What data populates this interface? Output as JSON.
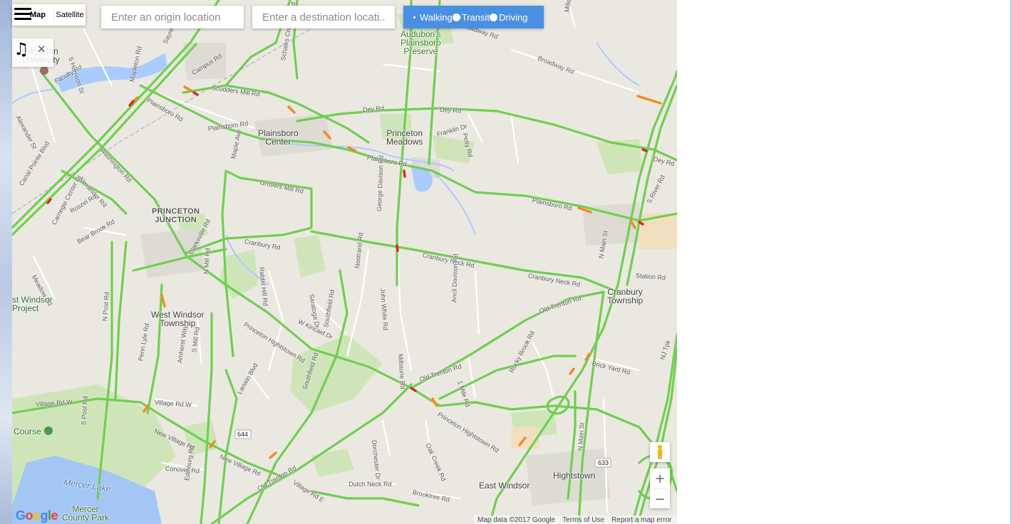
{
  "map_type": {
    "map_label": "Map",
    "satellite_label": "Satellite",
    "selected": "Map"
  },
  "origin": {
    "placeholder": "Enter an origin location",
    "value": ""
  },
  "destination": {
    "placeholder": "Enter a destination locati...",
    "value": ""
  },
  "travel_modes": {
    "selected": "Walking",
    "walking": "Walking",
    "transit": "Transit",
    "driving": "Driving"
  },
  "icons": {
    "menu": "hamburger-icon",
    "music": "music-note-icon",
    "close": "close-icon",
    "pegman": "pegman-icon",
    "zoom_in": "plus-icon",
    "zoom_out": "minus-icon"
  },
  "zoom": {
    "in": "+",
    "out": "−"
  },
  "attribution": {
    "data": "Map data ©2017 Google",
    "terms": "Terms of Use",
    "report": "Report a map error"
  },
  "logo": "Google",
  "places": {
    "princeton_university": "Princeton\nUniversity",
    "plainsboro_center": "Plainsboro\nCenter",
    "princeton_meadows": "Princeton\nMeadows",
    "audubon": "Audubon's\nPlainsboro\nPreserve",
    "princeton_junction": "PRINCETON\nJUNCTION",
    "west_windsor": "West Windsor\nTownship",
    "cranbury": "Cranbury\nTownship",
    "hightstown": "Hightstown",
    "east_windsor": "East Windsor",
    "mercer_lake": "Mercer Lake",
    "mercer_park": "Mercer\nCounty Park",
    "windsor_project": "st Windsor\nProject",
    "course": "Course"
  },
  "roads": {
    "broadway": "Broadway Rd",
    "dey1": "Dey Rd",
    "dey2": "Dey Rd",
    "dey3": "Dey Rd",
    "scudders": "Scudders Mill Rd",
    "plainsboro1": "Plainsboro Rd",
    "plainsboro2": "Plainsboro Rd",
    "plainsboro3": "Plainsboro Rd",
    "plainsboro4": "Plainsboro Rd",
    "groversmill": "Grovers Mill Rd",
    "cranbury": "Cranbury Rd",
    "cranburyneck1": "Cranbury Neck Rd",
    "cranburyneck2": "Cranbury Neck Rd",
    "station": "Station Rd",
    "oldtrenton1": "Old Trenton Rd",
    "oldtrenton2": "Old Trenton Rd",
    "oldtrenton3": "Old Trenton Rd",
    "pht1": "Princeton Hightstown Rd",
    "pht2": "Princeton Hightstown Rd",
    "villagew1": "Village Rd W",
    "villagew2": "Village Rd W",
    "newvillage1": "New Village Rd",
    "newvillage2": "New Village Rd",
    "villagee": "Village Rd E",
    "conover": "Conover Rd",
    "dutchneck": "Dutch Neck Rd",
    "brooktree": "Brooktree Rd",
    "brickyard": "Brick Yard Rd",
    "nmain1": "N Main St",
    "nmain2": "N Main St",
    "sriver": "S River Rd",
    "washington": "Washington Rd",
    "alexander1": "Alexander Rd",
    "alexander2": "Alexander St",
    "harrison": "S Harrison St",
    "canalpointe": "Canal Pointe Blvd",
    "roszel": "Roszel Rd",
    "bearbrook": "Bear Brook Rd",
    "meadow": "Meadow Rd",
    "clarksville": "Clarksville Rd",
    "nmill": "N Mill Rd",
    "rabbithill": "Rabbit Hill Rd",
    "saratoga": "Saratoga Dr",
    "wkincaid": "W Kincaid Dr",
    "southfield1": "Southfield Rd",
    "southfield2": "Southfield Rd",
    "nostrand": "Nostrand Rd",
    "johnwhite": "John White Rd",
    "georgedavison": "George Davison Rd",
    "millstone": "Millstone Rd",
    "ancildavison": "Ancil Davison Rd",
    "npost": "N Post Rd",
    "spost": "S Post Rd",
    "pennlyle": "Penn Lyle Rd",
    "amherst": "Amherst Way",
    "smill": "S Mill Rd",
    "lanwin": "Lanwin Blvd",
    "edinburg": "Edinburg Rd",
    "oakcreek": "Oak Creek Rd",
    "dorchester": "Dorchester Dr",
    "onemile": "1 Mile Rd",
    "rockybrook": "Rocky Brook Rd",
    "schalks": "Schalks Crossing Rd",
    "maple": "Maple Ave",
    "franklin": "Franklin Dr",
    "petty": "Petty Rd",
    "campus": "Campus Rd",
    "faculty": "Faculty Rd",
    "mapleton": "Mapleton Rd",
    "sayre": "Sayre Dr",
    "carnegie": "Carnegie Center Dr",
    "njtpk": "NJ Tpk",
    "miller": "Miller",
    "shield644": "644",
    "shield633": "633"
  }
}
